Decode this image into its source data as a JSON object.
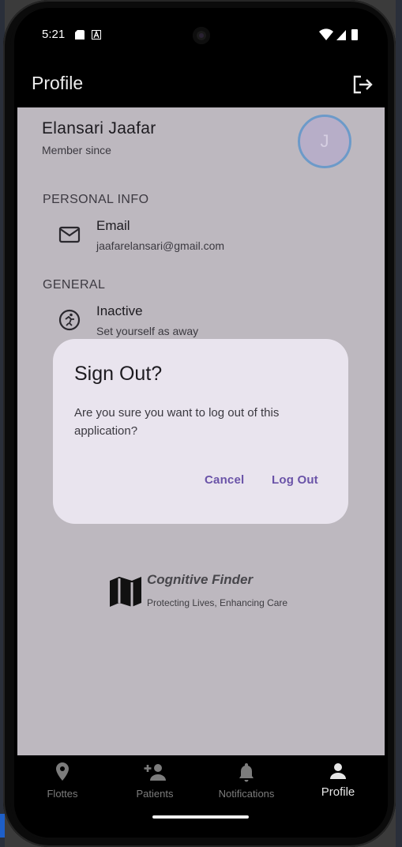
{
  "status_bar": {
    "time": "5:21"
  },
  "app_bar": {
    "title": "Profile",
    "action_icon": "logout-icon"
  },
  "profile": {
    "name": "Elansari Jaafar",
    "member_since": "Member since",
    "avatar_initial": "J",
    "avatar_ring_color": "#6c9ac9"
  },
  "sections": {
    "personal_info": "PERSONAL INFO",
    "general": "GENERAL"
  },
  "rows": {
    "email": {
      "title": "Email",
      "value": "jaafarelansari@gmail.com",
      "icon": "mail-icon"
    },
    "inactive": {
      "title": "Inactive",
      "subtitle": "Set yourself as away",
      "icon": "away-icon"
    }
  },
  "dialog": {
    "title": "Sign Out?",
    "message": "Are you sure you want to log out of this application?",
    "cancel_label": "Cancel",
    "confirm_label": "Log Out",
    "accent_color": "#6a53a8"
  },
  "brand": {
    "name": "Cognitive Finder",
    "tagline": "Protecting Lives, Enhancing Care"
  },
  "nav": {
    "items": [
      {
        "label": "Flottes",
        "icon": "location-pin-icon",
        "active": false
      },
      {
        "label": "Patients",
        "icon": "add-person-icon",
        "active": false
      },
      {
        "label": "Notifications",
        "icon": "bell-icon",
        "active": false
      },
      {
        "label": "Profile",
        "icon": "person-icon",
        "active": true
      }
    ]
  }
}
